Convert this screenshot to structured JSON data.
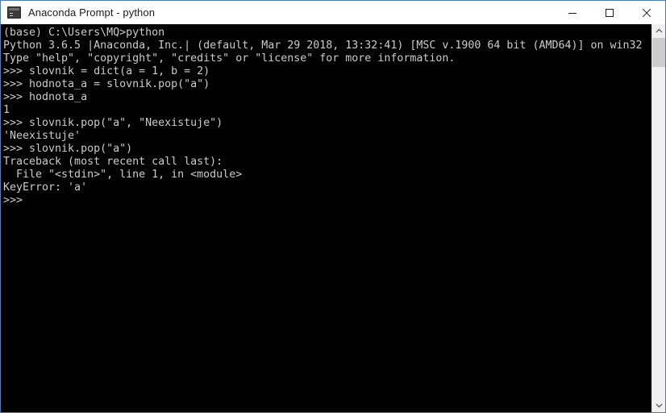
{
  "window": {
    "title": "Anaconda Prompt - python",
    "icon": "console-icon",
    "border_color": "#4a7ebb",
    "titlebar_background": "#ffffff",
    "titlebar_text_color": "#1a1a1a"
  },
  "controls": {
    "minimize_label": "Minimize",
    "maximize_label": "Maximize",
    "close_label": "Close"
  },
  "console": {
    "background": "#000000",
    "foreground": "#cccccc",
    "lines": [
      "(base) C:\\Users\\MQ>python",
      "Python 3.6.5 |Anaconda, Inc.| (default, Mar 29 2018, 13:32:41) [MSC v.1900 64 bit (AMD64)] on win32",
      "Type \"help\", \"copyright\", \"credits\" or \"license\" for more information.",
      ">>> slovnik = dict(a = 1, b = 2)",
      ">>> hodnota_a = slovnik.pop(\"a\")",
      ">>> hodnota_a",
      "1",
      ">>> slovnik.pop(\"a\", \"Neexistuje\")",
      "'Neexistuje'",
      ">>> slovnik.pop(\"a\")",
      "Traceback (most recent call last):",
      "  File \"<stdin>\", line 1, in <module>",
      "KeyError: 'a'",
      ">>>"
    ]
  },
  "scrollbar": {
    "up_arrow_label": "Scroll up",
    "down_arrow_label": "Scroll down",
    "thumb_label": "Scroll thumb",
    "track_color": "#f0f0f0",
    "thumb_color": "#cdcdcd"
  }
}
